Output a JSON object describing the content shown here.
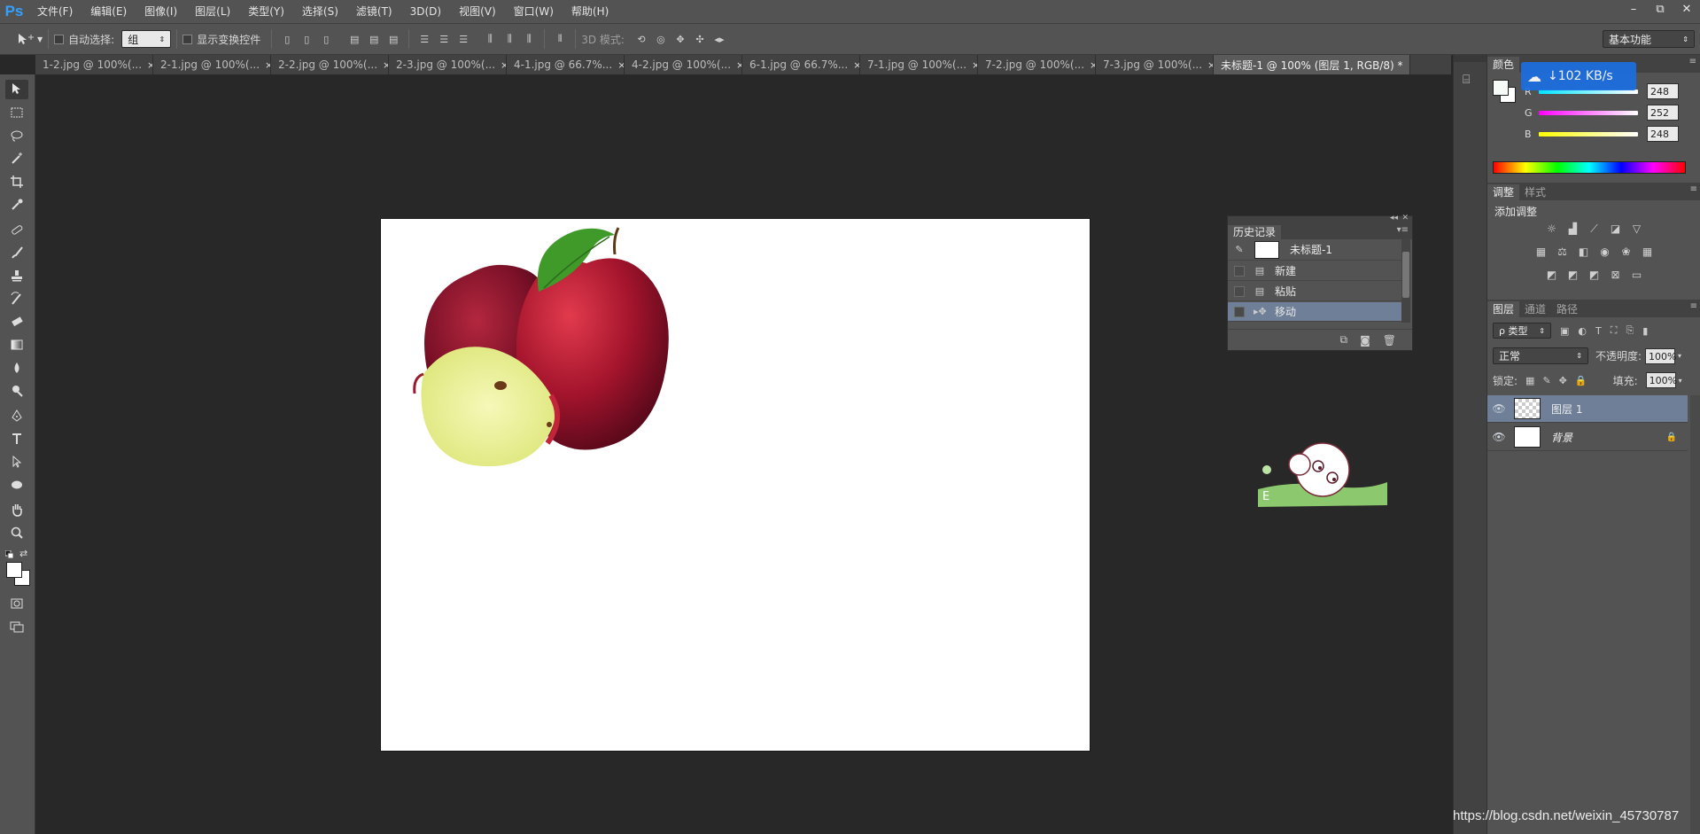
{
  "app": {
    "logo": "Ps"
  },
  "menu": [
    "文件(F)",
    "编辑(E)",
    "图像(I)",
    "图层(L)",
    "类型(Y)",
    "选择(S)",
    "滤镜(T)",
    "3D(D)",
    "视图(V)",
    "窗口(W)",
    "帮助(H)"
  ],
  "window_controls": {
    "minimize": "–",
    "restore": "⧉",
    "close": "✕"
  },
  "options": {
    "auto_select_label": "自动选择:",
    "auto_select_value": "组",
    "show_transform_label": "显示变换控件",
    "mode_3d_label": "3D 模式:",
    "workspace": "基本功能"
  },
  "tabs": [
    {
      "label": "1-2.jpg @ 100%(...",
      "active": false
    },
    {
      "label": "2-1.jpg @ 100%(...",
      "active": false
    },
    {
      "label": "2-2.jpg @ 100%(...",
      "active": false
    },
    {
      "label": "2-3.jpg @ 100%(...",
      "active": false
    },
    {
      "label": "4-1.jpg @ 66.7%...",
      "active": false
    },
    {
      "label": "4-2.jpg @ 100%(...",
      "active": false
    },
    {
      "label": "6-1.jpg @ 66.7%...",
      "active": false
    },
    {
      "label": "7-1.jpg @ 100%(...",
      "active": false
    },
    {
      "label": "7-2.jpg @ 100%(...",
      "active": false
    },
    {
      "label": "7-3.jpg @ 100%(...",
      "active": false
    },
    {
      "label": "未标题-1 @ 100% (图层 1, RGB/8) *",
      "active": true
    }
  ],
  "tab_close": "×",
  "color_panel": {
    "tabs": [
      "颜色"
    ],
    "r_label": "R",
    "g_label": "G",
    "b_label": "B",
    "r": "248",
    "g": "252",
    "b": "248",
    "r_color": "#00e5ff",
    "g_color": "#ff00ff",
    "b_color": "#ffff00"
  },
  "net_speed": "↓102 KB/s",
  "adjust_panel": {
    "tabs": [
      "调整",
      "样式"
    ],
    "title": "添加调整"
  },
  "layers_panel": {
    "tabs": [
      "图层",
      "通道",
      "路径"
    ],
    "filter": "ρ 类型",
    "blend_mode": "正常",
    "opacity_label": "不透明度:",
    "opacity_value": "100%",
    "lock_label": "锁定:",
    "fill_label": "填充:",
    "fill_value": "100%",
    "layers": [
      {
        "name": "图层 1",
        "selected": true
      },
      {
        "name": "背景",
        "selected": false
      }
    ]
  },
  "history_panel": {
    "tab": "历史记录",
    "snapshot": "未标题-1",
    "items": [
      {
        "label": "新建",
        "selected": false
      },
      {
        "label": "粘贴",
        "selected": false
      },
      {
        "label": "移动",
        "selected": true
      }
    ]
  },
  "watermark": "https://blog.csdn.net/weixin_45730787"
}
